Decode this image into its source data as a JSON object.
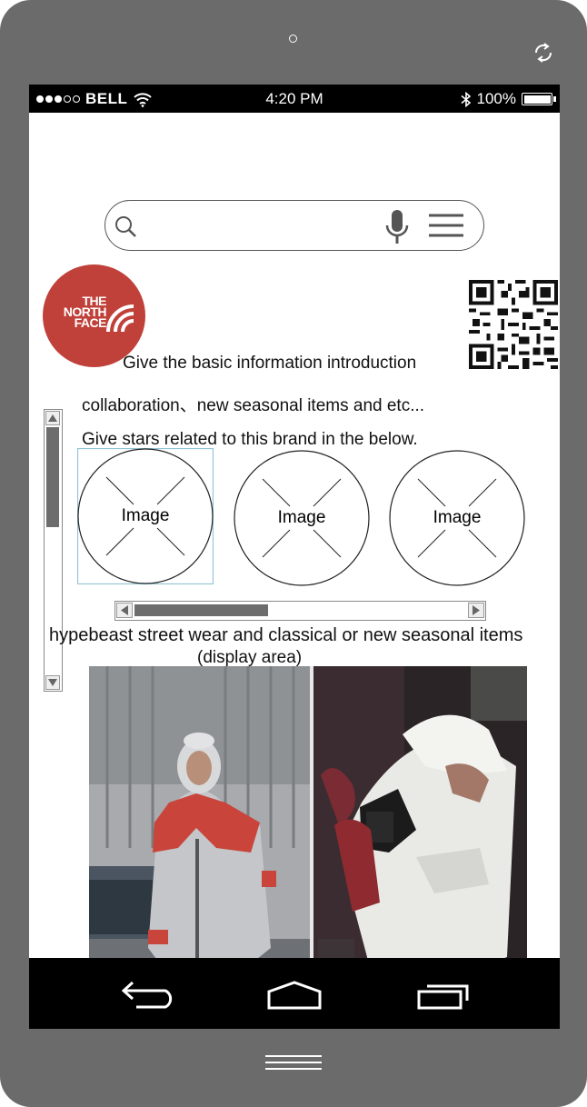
{
  "status_bar": {
    "carrier": "BELL",
    "time": "4:20 PM",
    "battery": "100%"
  },
  "search": {
    "placeholder": "",
    "icons": [
      "search-icon",
      "microphone-icon",
      "menu-icon"
    ]
  },
  "brand_logo": {
    "text_lines": [
      "THE",
      "NORTH",
      "FACE"
    ],
    "color": "#c0413a"
  },
  "content": {
    "intro": "Give the basic information introduction",
    "collab": "collaboration、new seasonal items and etc...",
    "stars_prompt": "Give stars related to this brand in the below.",
    "images": [
      "Image",
      "Image",
      "Image"
    ],
    "display_title": "hypebeast street wear and classical or new seasonal items",
    "display_sub": "(display area)"
  },
  "nav": {
    "icons": [
      "back-icon",
      "home-icon",
      "recent-apps-icon"
    ]
  }
}
